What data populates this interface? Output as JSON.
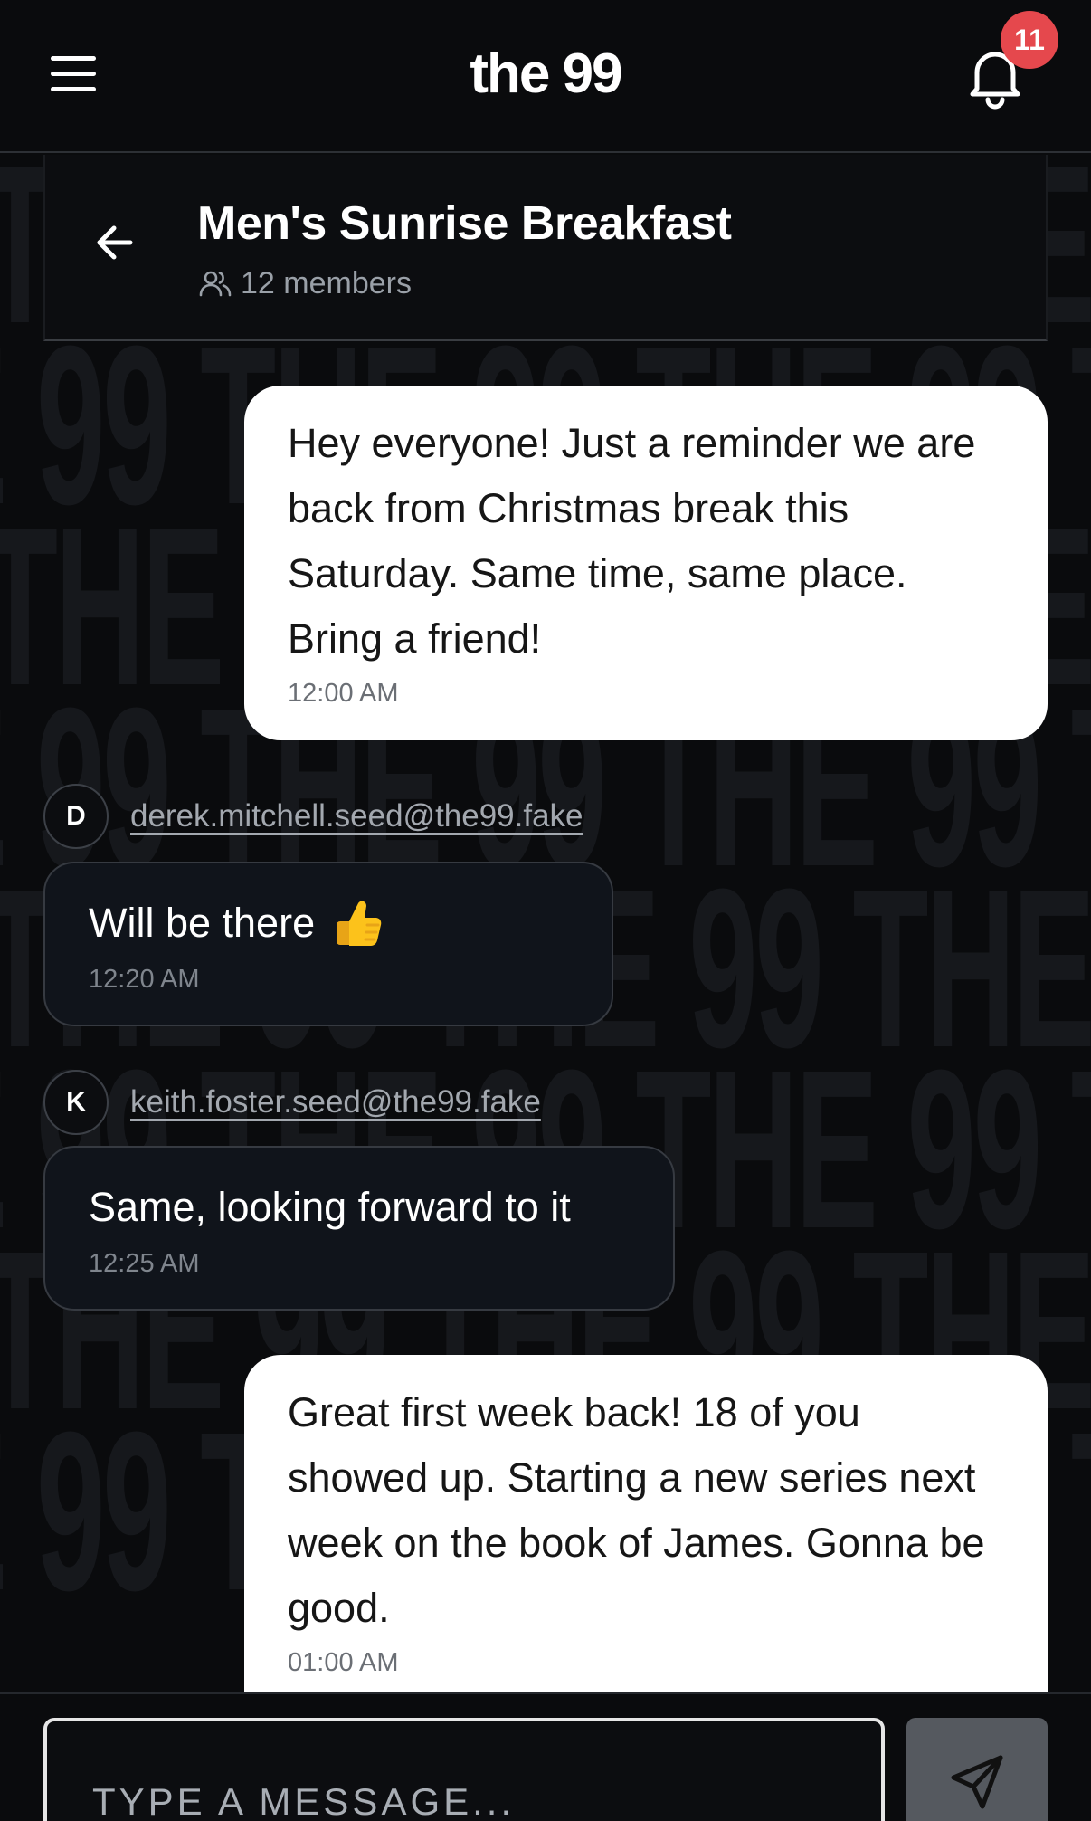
{
  "app": {
    "logo": "the 99",
    "notification_count": "11",
    "watermark": "THE 99"
  },
  "group": {
    "name": "Men's Sunrise Breakfast",
    "members": "12 members"
  },
  "messages": [
    {
      "type": "own",
      "text": "Hey everyone! Just a reminder we are back from Christmas break this Saturday. Same time, same place. Bring a friend!",
      "time": "12:00 AM"
    },
    {
      "type": "other",
      "initial": "D",
      "sender": "derek.mitchell.seed@the99.fake",
      "text": "Will be there",
      "emoji": "thumbs-up-icon",
      "time": "12:20 AM"
    },
    {
      "type": "other",
      "initial": "K",
      "sender": "keith.foster.seed@the99.fake",
      "text": "Same, looking forward to it",
      "time": "12:25 AM"
    },
    {
      "type": "own",
      "text": "Great first week back! 18 of you showed up. Starting a new series next week on the book of James. Gonna be good.",
      "time": "01:00 AM"
    }
  ],
  "composer": {
    "placeholder": "TYPE A MESSAGE..."
  },
  "colors": {
    "background": "#0a0b0d",
    "badge": "#e5484d",
    "own_bubble": "#ffffff",
    "other_bubble": "#10141b",
    "send_button": "#55595f"
  }
}
